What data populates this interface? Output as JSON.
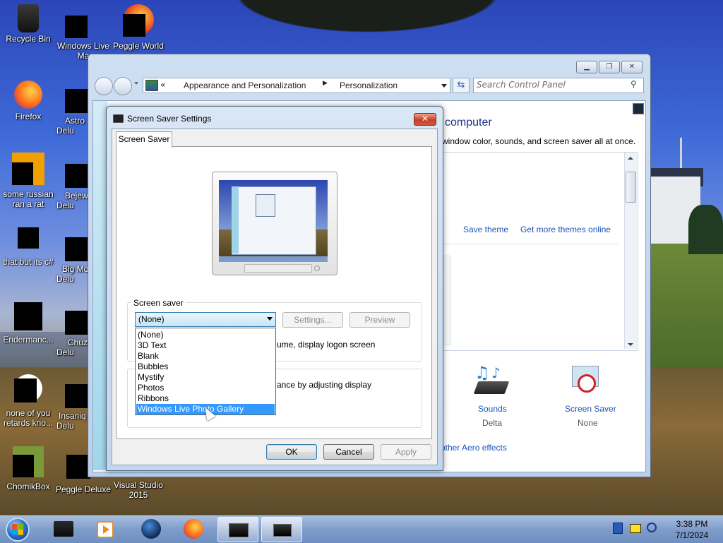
{
  "desktop": {
    "icons": [
      {
        "label": "Recycle Bin"
      },
      {
        "label": "Windows Live Ma"
      },
      {
        "label": "Peggle World"
      },
      {
        "label": "Firefox"
      },
      {
        "label": "Astro Delu"
      },
      {
        "label": "some russian ran a rat"
      },
      {
        "label": "Bejew Delu"
      },
      {
        "label": "that but its c#"
      },
      {
        "label": "Big Mo Delu"
      },
      {
        "label": "Endermanc..."
      },
      {
        "label": "Chuz Delu"
      },
      {
        "label": "none of you retards kno..."
      },
      {
        "label": "Insaniq Delu"
      },
      {
        "label": "ChomikBox"
      },
      {
        "label": "Peggle Deluxe"
      },
      {
        "label": "Visual Studio 2015"
      }
    ]
  },
  "control_panel": {
    "breadcrumb": {
      "overflow": "«",
      "items": [
        "Appearance and Personalization",
        "Personalization"
      ]
    },
    "search_placeholder": "Search Control Panel",
    "heading_fragment": "computer",
    "description_fragment": "window color, sounds, and screen saver all at once.",
    "save_theme": "Save theme",
    "get_more_themes": "Get more themes online",
    "sounds_label": "Sounds",
    "sounds_value": "Delta",
    "screen_saver_label": "Screen Saver",
    "screen_saver_value": "None",
    "aero_link": "other Aero effects"
  },
  "dialog": {
    "title": "Screen Saver Settings",
    "close_symbol": "✕",
    "tab_label": "Screen Saver",
    "group_label": "Screen saver",
    "selected_value": "(None)",
    "options": [
      "(None)",
      "3D Text",
      "Blank",
      "Bubbles",
      "Mystify",
      "Photos",
      "Ribbons",
      "Windows Live Photo Gallery"
    ],
    "highlighted_option": "Windows Live Photo Gallery",
    "settings_button": "Settings...",
    "preview_button": "Preview",
    "resume_text_fragment": "ume, display logon screen",
    "power_text_fragment": "ance by adjusting display",
    "ok_button": "OK",
    "cancel_button": "Cancel",
    "apply_button": "Apply"
  },
  "taskbar": {
    "time": "3:38 PM",
    "date": "7/1/2024"
  },
  "colors": {
    "accent_blue": "#3399ff",
    "link_blue": "#1a56b8",
    "close_red": "#c8402a"
  }
}
